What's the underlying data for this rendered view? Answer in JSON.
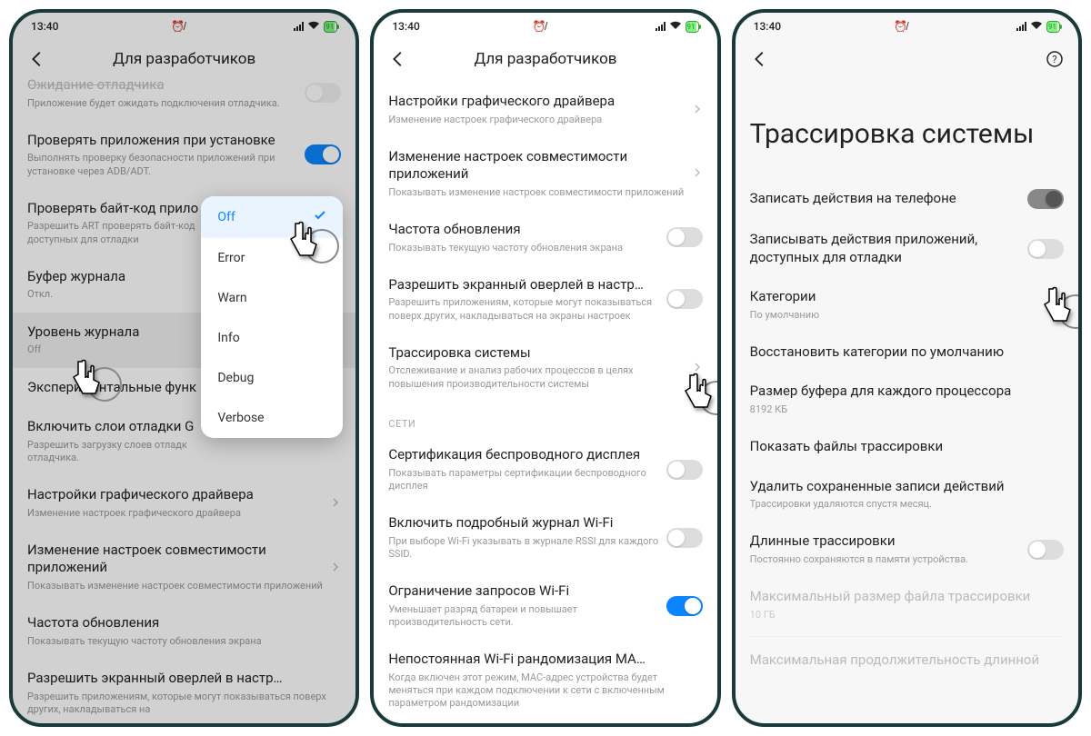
{
  "status": {
    "time": "13:40",
    "battery": "91"
  },
  "header": {
    "dev": "Для разработчиков"
  },
  "p1": {
    "r0": {
      "label": "Ожидание отладчика",
      "sub": "Приложение будет ожидать подключения отладчика."
    },
    "r1": {
      "label": "Проверять приложения при установке",
      "sub": "Выполнять проверку безопасности приложений при установке через ADB/ADT."
    },
    "r2": {
      "label": "Проверять байт-код прило",
      "sub": "Разрешить ART проверять байт-код\nдоступных для отладки"
    },
    "r3": {
      "label": "Буфер журнала",
      "sub": "Откл."
    },
    "r4": {
      "label": "Уровень журнала",
      "sub": "Off"
    },
    "r5": {
      "label": "Экспериментальные функ"
    },
    "r6": {
      "label": "Включить слои отладки G",
      "sub": "Разрешить загрузку слоев отладк\nотладчика."
    },
    "r7": {
      "label": "Настройки графического драйвера",
      "sub": "Изменение настроек графического драйвера"
    },
    "r8": {
      "label": "Изменение настроек совместимости приложений",
      "sub": "Показывать изменение настроек совместимости приложений"
    },
    "r9": {
      "label": "Частота обновления",
      "sub": "Показывать текущую частоту обновления экрана"
    },
    "r10": {
      "label": "Разрешить экранный оверлей в настр…",
      "sub": "Разрешить приложениям, которые могут показываться поверх других, накладываться на"
    },
    "popup": [
      "Off",
      "Error",
      "Warn",
      "Info",
      "Debug",
      "Verbose"
    ]
  },
  "p2": {
    "r1": {
      "label": "Настройки графического драйвера",
      "sub": "Изменение настроек графического драйвера"
    },
    "r2": {
      "label": "Изменение настроек совместимости приложений",
      "sub": "Показывать изменение настроек совместимости приложений"
    },
    "r3": {
      "label": "Частота обновления",
      "sub": "Показывать текущую частоту обновления экрана"
    },
    "r4": {
      "label": "Разрешить экранный оверлей в настр…",
      "sub": "Разрешить приложениям, которые могут показываться поверх других, накладываться на экраны настроек"
    },
    "r5": {
      "label": "Трассировка системы",
      "sub": "Отслеживание и анализ рабочих процессов в целях повышения производительности системы"
    },
    "section": "СЕТИ",
    "r6": {
      "label": "Сертификация беспроводного дисплея",
      "sub": "Показывать параметры сертификации беспроводного дисплея"
    },
    "r7": {
      "label": "Включить подробный журнал Wi-Fi",
      "sub": "При выборе Wi-Fi указывать в журнале RSSI для каждого SSID."
    },
    "r8": {
      "label": "Ограничение запросов Wi-Fi",
      "sub": "Уменьшает разряд батареи и повышает производительность сети."
    },
    "r9": {
      "label": "Непостоянная Wi-Fi рандомизация MA…",
      "sub": "Когда включен этот режим, MAC-адрес устройства будет меняться при каждом подключении к сети с включенным параметром рандомизации"
    }
  },
  "p3": {
    "title": "Трассировка системы",
    "r1": {
      "label": "Записать действия на телефоне"
    },
    "r2": {
      "label": "Записывать действия приложений, доступных для отладки"
    },
    "r3": {
      "label": "Категории",
      "sub": "По умолчанию"
    },
    "r4": {
      "label": "Восстановить категории по умолчанию"
    },
    "r5": {
      "label": "Размер буфера для каждого процессора",
      "sub": "8192 КБ"
    },
    "r6": {
      "label": "Показать файлы трассировки"
    },
    "r7": {
      "label": "Удалить сохраненные записи действий",
      "sub": "Трассировки удаляются спустя месяц."
    },
    "r8": {
      "label": "Длинные трассировки",
      "sub": "Постоянно сохраняются в памяти устройства."
    },
    "r9": {
      "label": "Максимальный размер файла трассировки",
      "sub": "10 ГБ"
    },
    "r10": {
      "label": "Максимальная продолжительность длинной"
    }
  }
}
